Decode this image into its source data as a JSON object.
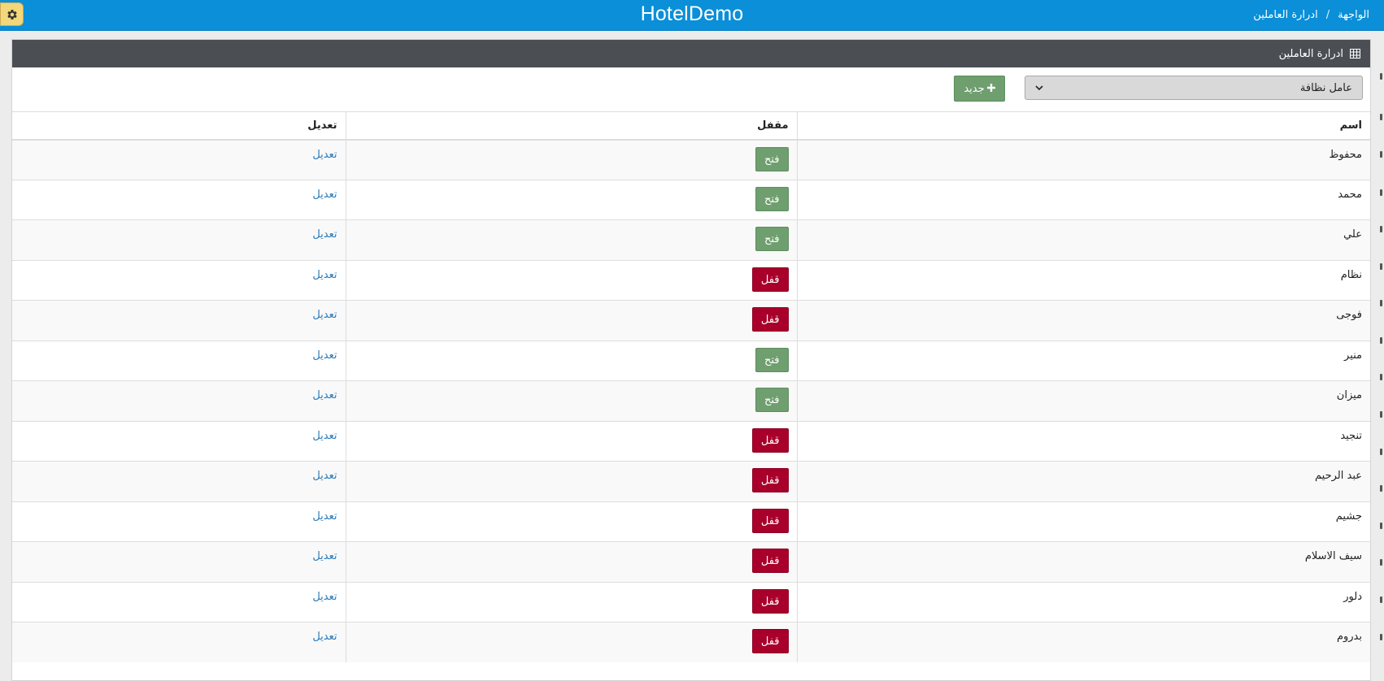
{
  "header": {
    "title": "HotelDemo",
    "breadcrumb": {
      "home": "الواجهة",
      "separator": "/",
      "current": "ادرارة العاملين"
    },
    "settings_icon": "gear-icon"
  },
  "panel": {
    "title": "ادرارة العاملين",
    "icon": "table-icon"
  },
  "toolbar": {
    "filter_value": "عامل نظافة",
    "new_label": "جديد",
    "new_icon": "plus-icon"
  },
  "table": {
    "columns": {
      "name": "اسم",
      "locked": "مقفل",
      "edit": "تعديل"
    },
    "rows": [
      {
        "name": "محفوظ",
        "lock_label": "فتح",
        "locked": false,
        "edit_label": "تعديل"
      },
      {
        "name": "محمد",
        "lock_label": "فتح",
        "locked": false,
        "edit_label": "تعديل"
      },
      {
        "name": "علي",
        "lock_label": "فتح",
        "locked": false,
        "edit_label": "تعديل"
      },
      {
        "name": "نظام",
        "lock_label": "قفل",
        "locked": true,
        "edit_label": "تعديل"
      },
      {
        "name": "فوجى",
        "lock_label": "قفل",
        "locked": true,
        "edit_label": "تعديل"
      },
      {
        "name": "منير",
        "lock_label": "فتح",
        "locked": false,
        "edit_label": "تعديل"
      },
      {
        "name": "ميزان",
        "lock_label": "فتح",
        "locked": false,
        "edit_label": "تعديل"
      },
      {
        "name": "تنجيد",
        "lock_label": "قفل",
        "locked": true,
        "edit_label": "تعديل"
      },
      {
        "name": "عبد الرحيم",
        "lock_label": "قفل",
        "locked": true,
        "edit_label": "تعديل"
      },
      {
        "name": "جشيم",
        "lock_label": "قفل",
        "locked": true,
        "edit_label": "تعديل"
      },
      {
        "name": "سيف الاسلام",
        "lock_label": "قفل",
        "locked": true,
        "edit_label": "تعديل"
      },
      {
        "name": "دلور",
        "lock_label": "قفل",
        "locked": true,
        "edit_label": "تعديل"
      },
      {
        "name": "بدروم",
        "lock_label": "قفل",
        "locked": true,
        "edit_label": "تعديل"
      }
    ]
  },
  "colors": {
    "topbar": "#0a8fd8",
    "panel_header": "#4b4f54",
    "open_button": "#6f9e6f",
    "locked_button": "#a8002a",
    "link": "#2a7ab8"
  }
}
